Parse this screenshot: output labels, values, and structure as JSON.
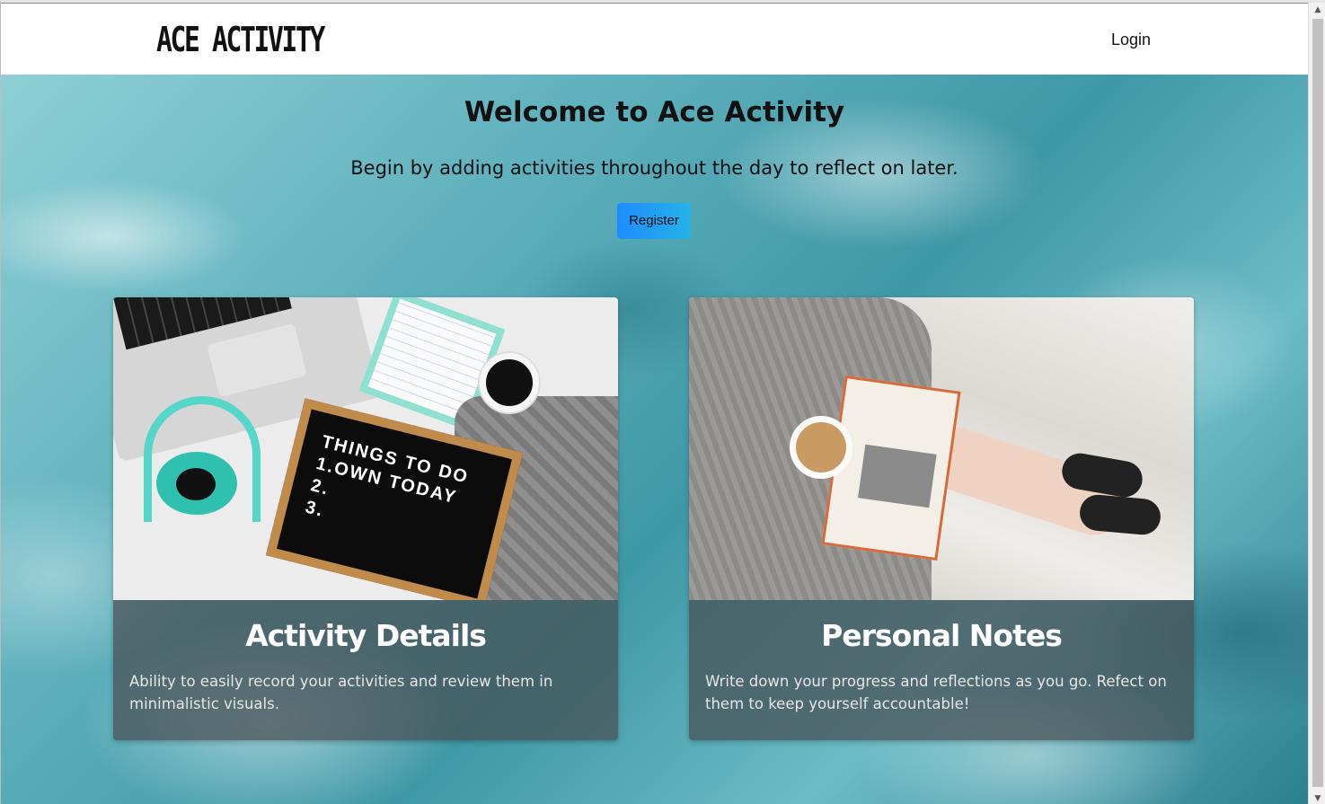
{
  "header": {
    "brand": "ACE ACTIVITY",
    "login_label": "Login"
  },
  "hero": {
    "title": "Welcome to Ace Activity",
    "subtitle": "Begin by adding activities throughout the day to reflect on later.",
    "register_label": "Register"
  },
  "cards": [
    {
      "title": "Activity Details",
      "text": "Ability to easily record your activities and review them in minimalistic visuals.",
      "image_text": [
        "THINGS TO DO",
        "1.OWN TODAY",
        "2.",
        "3."
      ]
    },
    {
      "title": "Personal Notes",
      "text": "Write down your progress and reflections as you go. Refect on them to keep yourself accountable!"
    }
  ],
  "colors": {
    "register_start": "#1e8cff",
    "register_end": "#25b3e8",
    "ocean": "#3f98a6"
  }
}
